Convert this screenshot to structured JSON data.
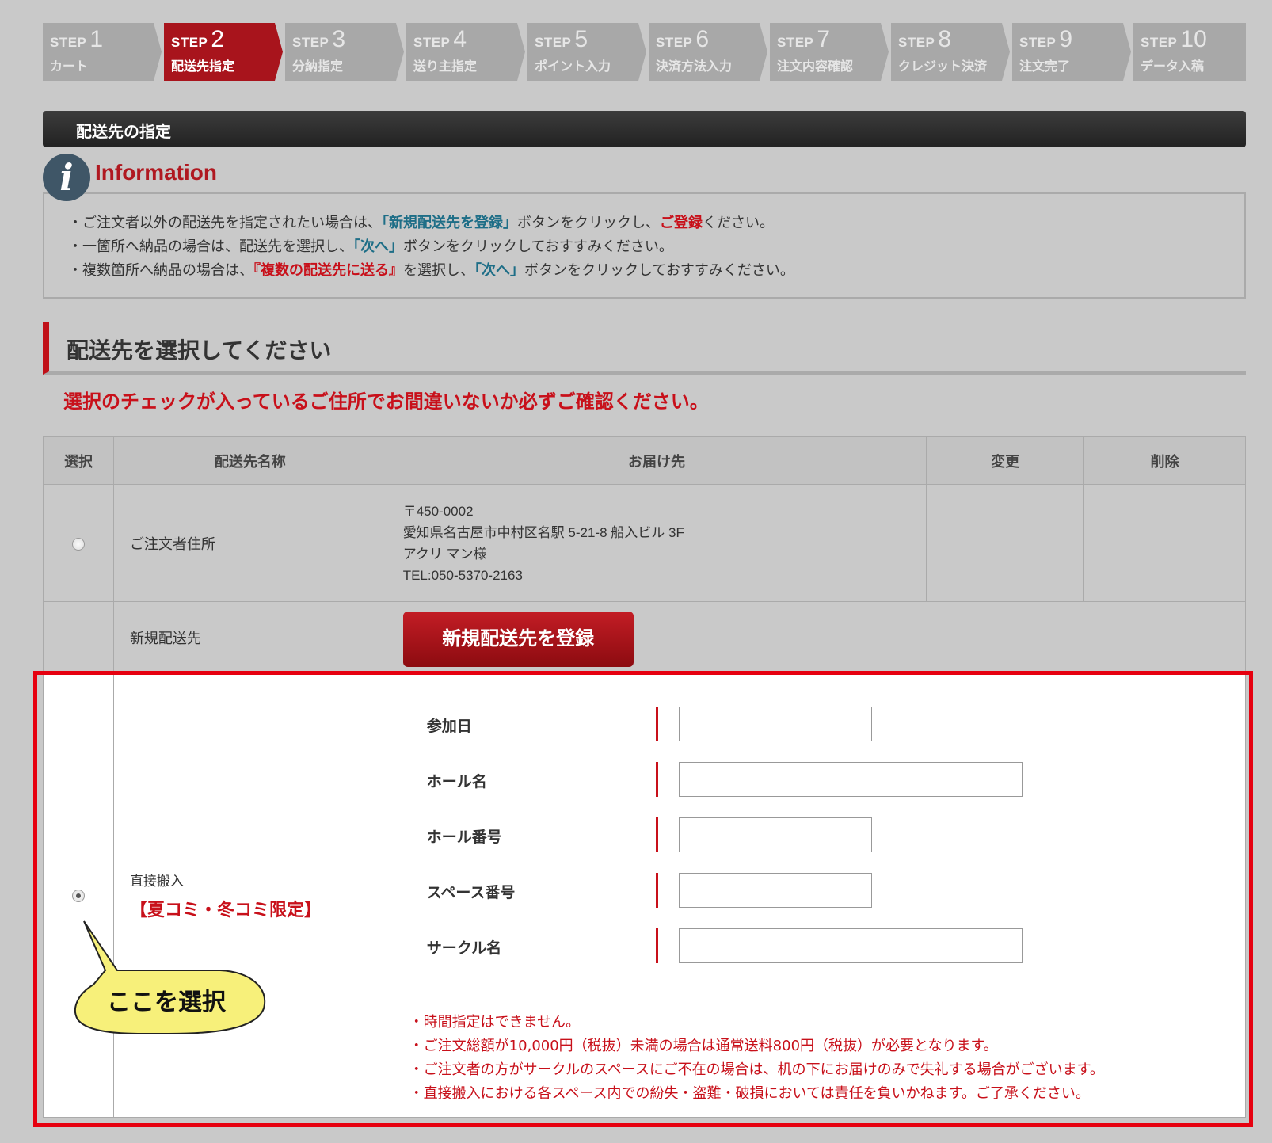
{
  "steps": [
    {
      "word": "STEP",
      "num": "1",
      "label": "カート"
    },
    {
      "word": "STEP",
      "num": "2",
      "label": "配送先指定"
    },
    {
      "word": "STEP",
      "num": "3",
      "label": "分納指定"
    },
    {
      "word": "STEP",
      "num": "4",
      "label": "送り主指定"
    },
    {
      "word": "STEP",
      "num": "5",
      "label": "ポイント入力"
    },
    {
      "word": "STEP",
      "num": "6",
      "label": "決済方法入力"
    },
    {
      "word": "STEP",
      "num": "7",
      "label": "注文内容確認"
    },
    {
      "word": "STEP",
      "num": "8",
      "label": "クレジット決済"
    },
    {
      "word": "STEP",
      "num": "9",
      "label": "注文完了"
    },
    {
      "word": "STEP",
      "num": "10",
      "label": "データ入稿"
    }
  ],
  "active_step": 2,
  "section_title": "配送先の指定",
  "info": {
    "icon_glyph": "i",
    "title": "Information",
    "line1": {
      "a": "・ご注文者以外の配送先を指定されたい場合は、",
      "b": "「新規配送先を登録」",
      "c": "ボタンをクリックし、",
      "d": "ご登録",
      "e": "ください。"
    },
    "line2": {
      "a": "・一箇所へ納品の場合は、配送先を選択し、",
      "b": "「次へ」",
      "c": "ボタンをクリックしておすすみください。"
    },
    "line3": {
      "a": "・複数箇所へ納品の場合は、",
      "b": "『複数の配送先に送る』",
      "c": "を選択し、",
      "d": "「次へ」",
      "e": "ボタンをクリックしておすすみください。"
    }
  },
  "heading": "配送先を選択してください",
  "warning": "選択のチェックが入っているご住所でお間違いないか必ずご確認ください。",
  "table": {
    "headers": [
      "選択",
      "配送先名称",
      "お届け先",
      "変更",
      "削除"
    ],
    "orderer": {
      "name": "ご注文者住所",
      "address_lines": [
        "〒450-0002",
        "愛知県名古屋市中村区名駅 5-21-8 船入ビル 3F",
        "アクリ マン様",
        "TEL:050-5370-2163"
      ]
    },
    "new_dest": {
      "name": "新規配送先",
      "button": "新規配送先を登録"
    },
    "direct": {
      "name": "直接搬入",
      "note": "【夏コミ・冬コミ限定】",
      "fields": [
        {
          "label": "参加日",
          "value": ""
        },
        {
          "label": "ホール名",
          "value": ""
        },
        {
          "label": "ホール番号",
          "value": ""
        },
        {
          "label": "スペース番号",
          "value": ""
        },
        {
          "label": "サークル名",
          "value": ""
        }
      ],
      "notes": [
        "・時間指定はできません。",
        "・ご注文総額が10,000円（税抜）未満の場合は通常送料800円（税抜）が必要となります。",
        "・ご注文者の方がサークルのスペースにご不在の場合は、机の下にお届けのみで失礼する場合がございます。",
        "・直接搬入における各スペース内での紛失・盗難・破損においては責任を負いかねます。ご了承ください。"
      ]
    }
  },
  "callout": "ここを選択",
  "colors": {
    "accent": "#a8141c",
    "highlight": "#e6000f",
    "callout_fill": "#f7f07a"
  }
}
